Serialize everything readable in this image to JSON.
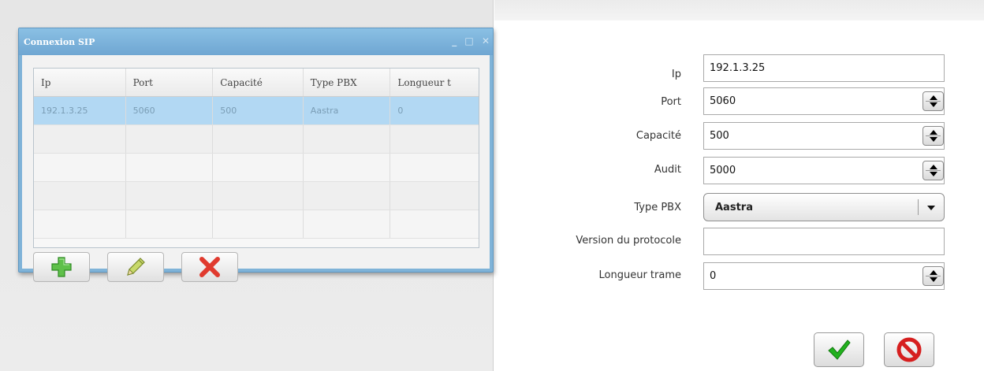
{
  "sip_window": {
    "title": "Connexion SIP",
    "controls": {
      "minimize": "_",
      "maximize": "□",
      "close": "✕"
    },
    "grid": {
      "columns": [
        "Ip",
        "Port",
        "Capacité",
        "Type PBX",
        "Longueur t"
      ],
      "rows": [
        [
          "192.1.3.25",
          "5060",
          "500",
          "Aastra",
          "0"
        ]
      ]
    },
    "toolbar": {
      "add_icon": "plus-icon",
      "edit_icon": "pencil-icon",
      "delete_icon": "red-x-icon"
    }
  },
  "form": {
    "ip": {
      "label": "Ip",
      "value": "192.1.3.25"
    },
    "port": {
      "label": "Port",
      "value": "5060"
    },
    "capacite": {
      "label": "Capacité",
      "value": "500"
    },
    "audit": {
      "label": "Audit",
      "value": "5000"
    },
    "type_pbx": {
      "label": "Type PBX",
      "value": "Aastra"
    },
    "version": {
      "label": "Version du protocole",
      "value": ""
    },
    "longueur": {
      "label": "Longueur trame",
      "value": "0"
    }
  },
  "actions": {
    "confirm_icon": "checkmark-icon",
    "cancel_icon": "no-entry-icon"
  },
  "colors": {
    "window_blue": "#7fb3d8",
    "selected_row": "#b2d8f3",
    "confirm_green": "#22b11e",
    "cancel_red": "#d61f1f"
  }
}
